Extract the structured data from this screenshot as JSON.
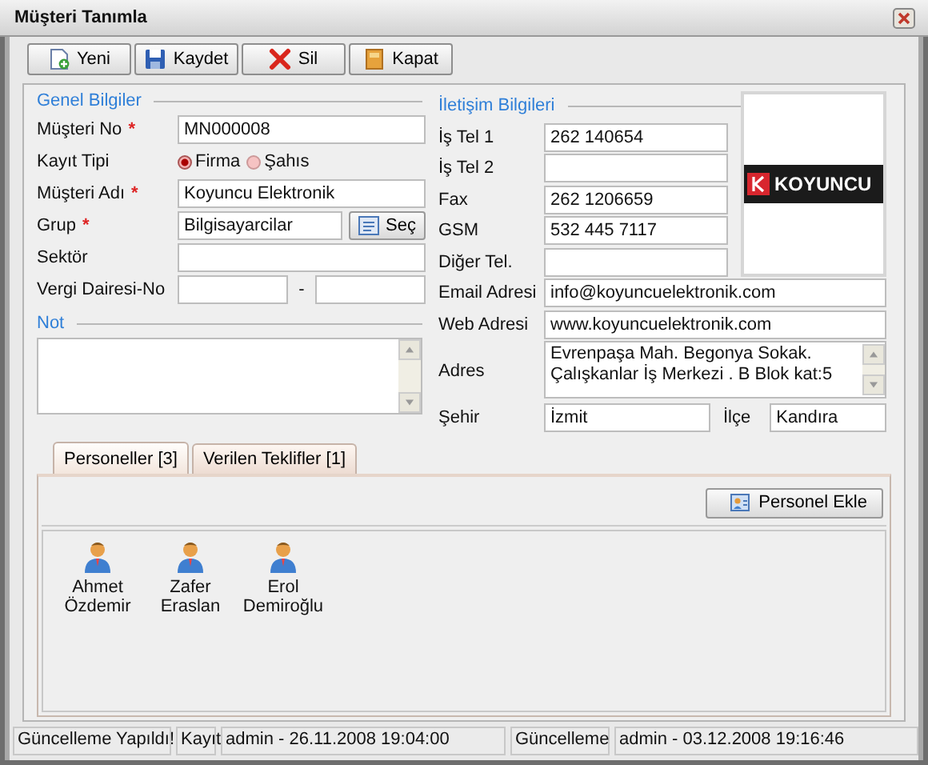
{
  "window": {
    "title": "Müşteri Tanımla"
  },
  "toolbar": [
    {
      "label": "Yeni"
    },
    {
      "label": "Kaydet"
    },
    {
      "label": "Sil"
    },
    {
      "label": "Kapat"
    }
  ],
  "general": {
    "title": "Genel Bilgiler",
    "fields": [
      {
        "kind": "text",
        "label": "Müşteri No",
        "mark": "*",
        "value": "MN000008"
      },
      {
        "kind": "radio",
        "label": "Kayıt Tipi",
        "options": [
          {
            "label": "Firma",
            "selected": true
          },
          {
            "label": "Şahıs",
            "selected": false
          }
        ]
      },
      {
        "kind": "text",
        "label": "Müşteri Adı",
        "mark": "*",
        "value": "Koyuncu Elektronik"
      },
      {
        "kind": "lookup",
        "label": "Grup",
        "mark": "*",
        "value": "Bilgisayarcilar",
        "button": "Seç"
      },
      {
        "kind": "text",
        "label": "Sektör"
      },
      {
        "kind": "split",
        "label": "Vergi Dairesi-No",
        "separator": "-"
      }
    ]
  },
  "note": {
    "title": "Not"
  },
  "contact": {
    "title": "İletişim Bilgileri",
    "fields": [
      {
        "kind": "text",
        "label": "İş Tel 1",
        "value": "262 140654"
      },
      {
        "kind": "text",
        "label": "İş Tel 2"
      },
      {
        "kind": "text",
        "label": "Fax",
        "value": "262 1206659"
      },
      {
        "kind": "text",
        "label": "GSM",
        "value": "532 445 7117"
      },
      {
        "kind": "text",
        "label": "Diğer Tel."
      },
      {
        "kind": "wide",
        "label": "Email Adresi",
        "value": "info@koyuncuelektronik.com"
      },
      {
        "kind": "wide",
        "label": "Web Adresi",
        "value": "www.koyuncuelektronik.com"
      },
      {
        "kind": "memo",
        "label": "Adres",
        "value": "Evrenpaşa Mah. Begonya Sokak. Çalışkanlar İş Merkezi . B Blok kat:5"
      },
      {
        "kind": "pair",
        "label": "Şehir",
        "value": "İzmit",
        "label2": "İlçe",
        "value2": "Kandıra"
      }
    ]
  },
  "logo": {
    "text": "KOYUNCU"
  },
  "tabs": [
    {
      "label": "Personeller [3]",
      "selected": true
    },
    {
      "label": "Verilen Teklifler [1]",
      "selected": false
    }
  ],
  "personnel": {
    "button": "Personel Ekle",
    "people": [
      {
        "name": "Ahmet Özdemir"
      },
      {
        "name": "Zafer Eraslan"
      },
      {
        "name": "Erol Demiroğlu"
      }
    ]
  },
  "status_bar": [
    "Güncelleme Yapıldı!",
    "Kayıt",
    "admin - 26.11.2008 19:04:00",
    "Güncelleme",
    "admin - 03.12.2008 19:16:46"
  ]
}
